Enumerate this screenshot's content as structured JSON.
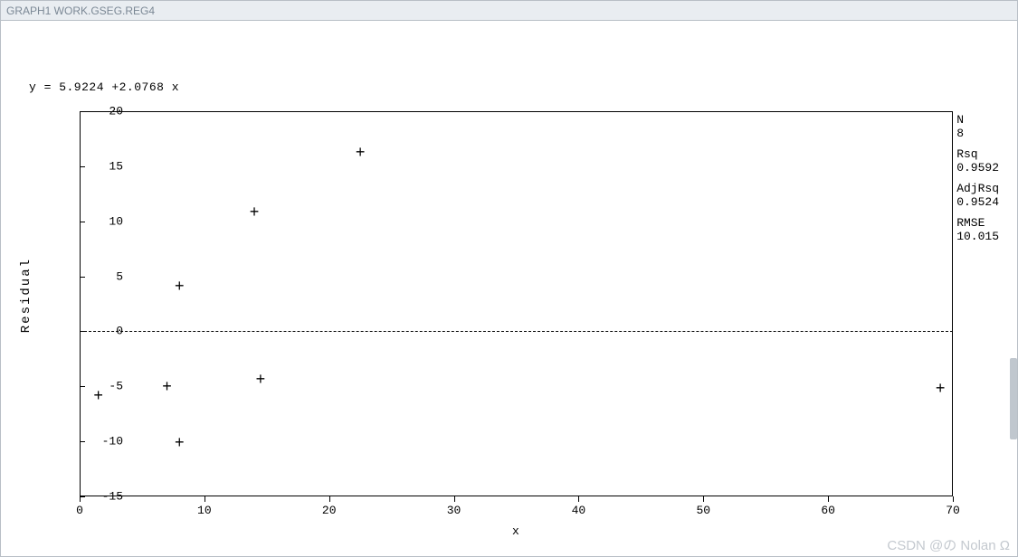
{
  "titlebar": "GRAPH1  WORK.GSEG.REG4",
  "equation": "y = 5.9224 +2.0768 x",
  "axes": {
    "ylabel": "Residual",
    "xlabel": "x",
    "yticks": [
      -15,
      -10,
      -5,
      0,
      5,
      10,
      15,
      20
    ],
    "xticks": [
      0,
      10,
      20,
      30,
      40,
      50,
      60,
      70
    ],
    "ymin": -15,
    "ymax": 20,
    "xmin": 0,
    "xmax": 70
  },
  "stats": {
    "n_label": "N",
    "n_value": "8",
    "rsq_label": "Rsq",
    "rsq_value": "0.9592",
    "adjrsq_label": "AdjRsq",
    "adjrsq_value": "0.9524",
    "rmse_label": "RMSE",
    "rmse_value": "10.015"
  },
  "watermark": "CSDN @の  Nolan  Ω",
  "chart_data": {
    "type": "scatter",
    "title": "",
    "equation": "y = 5.9224 + 2.0768 x",
    "xlabel": "x",
    "ylabel": "Residual",
    "xlim": [
      0,
      70
    ],
    "ylim": [
      -15,
      20
    ],
    "reference_lines": [
      {
        "axis": "y",
        "value": 0,
        "style": "dashed"
      }
    ],
    "series": [
      {
        "name": "residuals",
        "marker": "+",
        "x": [
          1.5,
          7,
          8,
          8,
          14,
          14.5,
          22.5,
          69
        ],
        "y": [
          -6,
          -5.1,
          4,
          -10.2,
          10.7,
          -4.5,
          16.1,
          -5.3
        ]
      }
    ],
    "stats": {
      "N": 8,
      "Rsq": 0.9592,
      "AdjRsq": 0.9524,
      "RMSE": 10.015
    }
  }
}
